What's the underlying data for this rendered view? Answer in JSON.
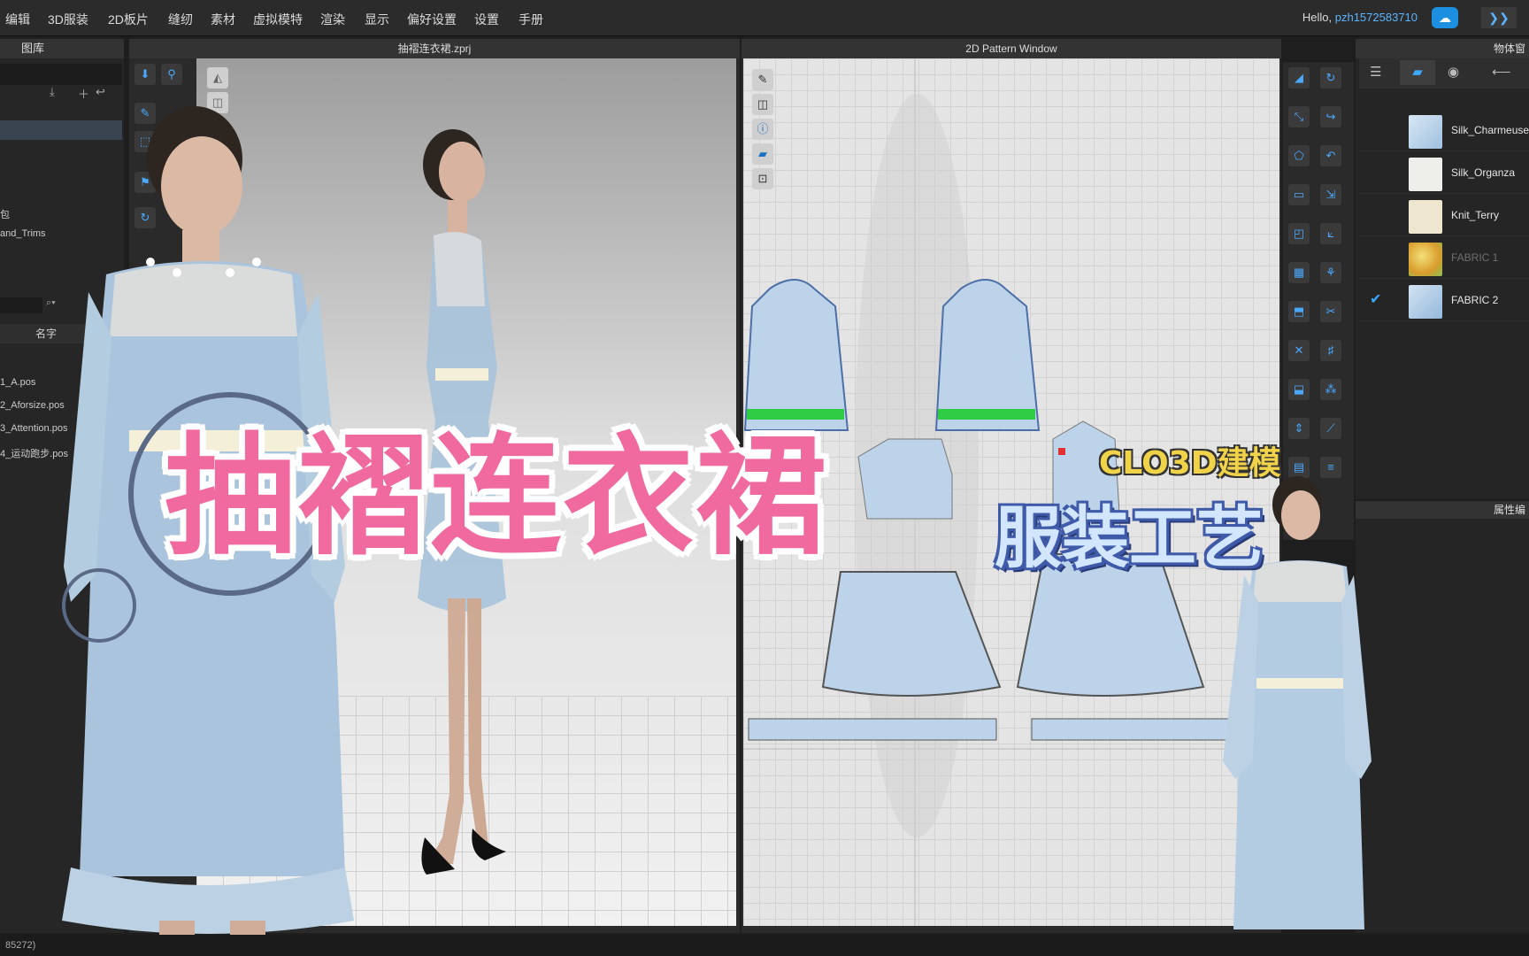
{
  "menu": [
    "编辑",
    "3D服装",
    "2D板片",
    "缝纫",
    "素材",
    "虚拟模特",
    "渲染",
    "显示",
    "偏好设置",
    "设置",
    "手册"
  ],
  "user": {
    "greeting": "Hello, ",
    "name": "pzh1572583710"
  },
  "library": {
    "title": "图库",
    "col_header": "名字",
    "items": [
      "包",
      "and_Trims"
    ],
    "files": [
      "1_A.pos",
      "2_Aforsize.pos",
      "3_Attention.pos",
      "4_运动跑步.pos"
    ]
  },
  "viewport3d": {
    "title": "抽褶连衣裙.zprj"
  },
  "pattern": {
    "title": "2D Pattern Window"
  },
  "object_browser": {
    "title": "物体窗",
    "fabrics": [
      {
        "name": "Silk_Charmeuse",
        "color": "#b9d3ea",
        "checked": false
      },
      {
        "name": "Silk_Organza",
        "color": "#eeeeea",
        "checked": false
      },
      {
        "name": "Knit_Terry",
        "color": "#efe6cf",
        "checked": false
      },
      {
        "name": "FABRIC 1",
        "color": "#e6c43a",
        "checked": false
      },
      {
        "name": "FABRIC 2",
        "color": "#a9c7e4",
        "checked": true
      }
    ]
  },
  "property_editor": {
    "title": "属性编"
  },
  "status": {
    "text": "85272)"
  },
  "overlay": {
    "main_title": "抽褶连衣裙",
    "sub_title1": "CLO3D建模",
    "sub_title2": "服装工艺"
  },
  "colors": {
    "accent": "#3da8ff",
    "title_pink": "#f06aa0"
  }
}
